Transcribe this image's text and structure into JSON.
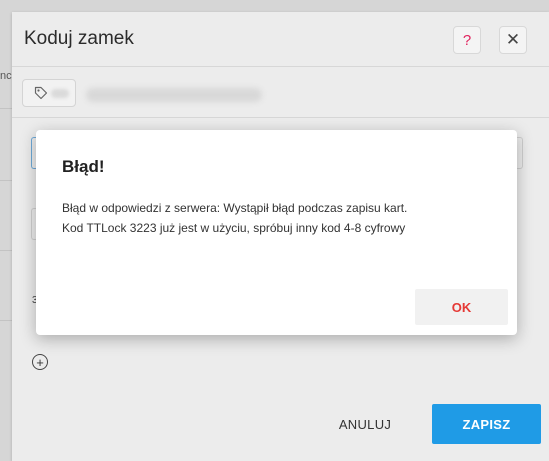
{
  "modal": {
    "title": "Koduj zamek",
    "help_label": "?",
    "close_label": "✕",
    "add_label": "+",
    "background_text": "3",
    "cancel_label": "ANULUJ",
    "save_label": "ZAPISZ"
  },
  "error_dialog": {
    "title": "Błąd!",
    "message_line1": "Błąd w odpowiedzi z serwera: Wystąpił błąd podczas zapisu kart.",
    "message_line2": "Kod TTLock 3223 już jest w użyciu, spróbuj inny kod 4-8 cyfrowy",
    "ok_label": "OK"
  },
  "background": {
    "edge_texts": [
      "nc",
      "o",
      "O",
      "o",
      "o"
    ]
  },
  "colors": {
    "primary": "#1f9be6",
    "danger": "#e53935",
    "help": "#e0245e"
  },
  "icons": {
    "tag": "tag-icon",
    "help": "question-icon",
    "close": "close-icon",
    "add": "plus-circle-icon"
  }
}
